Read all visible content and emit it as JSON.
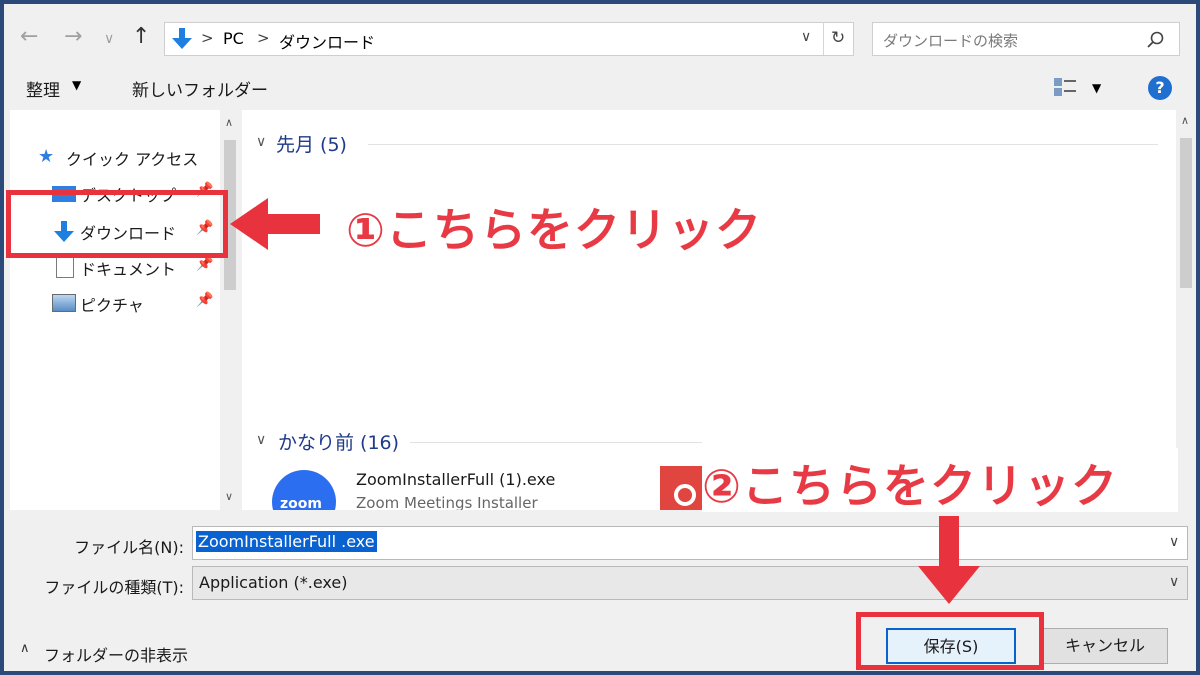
{
  "nav": {
    "back_icon": "arrow-left-icon",
    "forward_icon": "arrow-right-icon",
    "recent_icon": "chevron-down-icon",
    "up_icon": "arrow-up-icon"
  },
  "address": {
    "crumbs": [
      "PC",
      "ダウンロード"
    ],
    "separator": ">"
  },
  "search": {
    "placeholder": "ダウンロードの検索"
  },
  "toolbar": {
    "organize": "整理",
    "new_folder": "新しいフォルダー"
  },
  "sidebar": {
    "items": [
      {
        "label": "クイック アクセス",
        "icon": "star-icon"
      },
      {
        "label": "デスクトップ",
        "icon": "desktop-icon",
        "pinned": true
      },
      {
        "label": "ダウンロード",
        "icon": "download-icon",
        "pinned": true
      },
      {
        "label": "ドキュメント",
        "icon": "document-icon",
        "pinned": true
      },
      {
        "label": "ピクチャ",
        "icon": "picture-icon",
        "pinned": true
      }
    ]
  },
  "content": {
    "groups": [
      {
        "label": "先月 (5)"
      },
      {
        "label": "かなり前 (16)"
      }
    ],
    "files": [
      {
        "name": "ZoomInstallerFull (1).exe",
        "desc": "Zoom Meetings Installer",
        "icon_text": "zoom"
      }
    ]
  },
  "form": {
    "filename_label": "ファイル名(N):",
    "filename_value": "ZoomInstallerFull .exe",
    "filetype_label": "ファイルの種類(T):",
    "filetype_value": "Application (*.exe)"
  },
  "footer": {
    "hide_folders": "フォルダーの非表示",
    "save": "保存(S)",
    "cancel": "キャンセル"
  },
  "annotations": {
    "step1": "①こちらをクリック",
    "step2": "②こちらをクリック",
    "color": "#e8333e"
  }
}
